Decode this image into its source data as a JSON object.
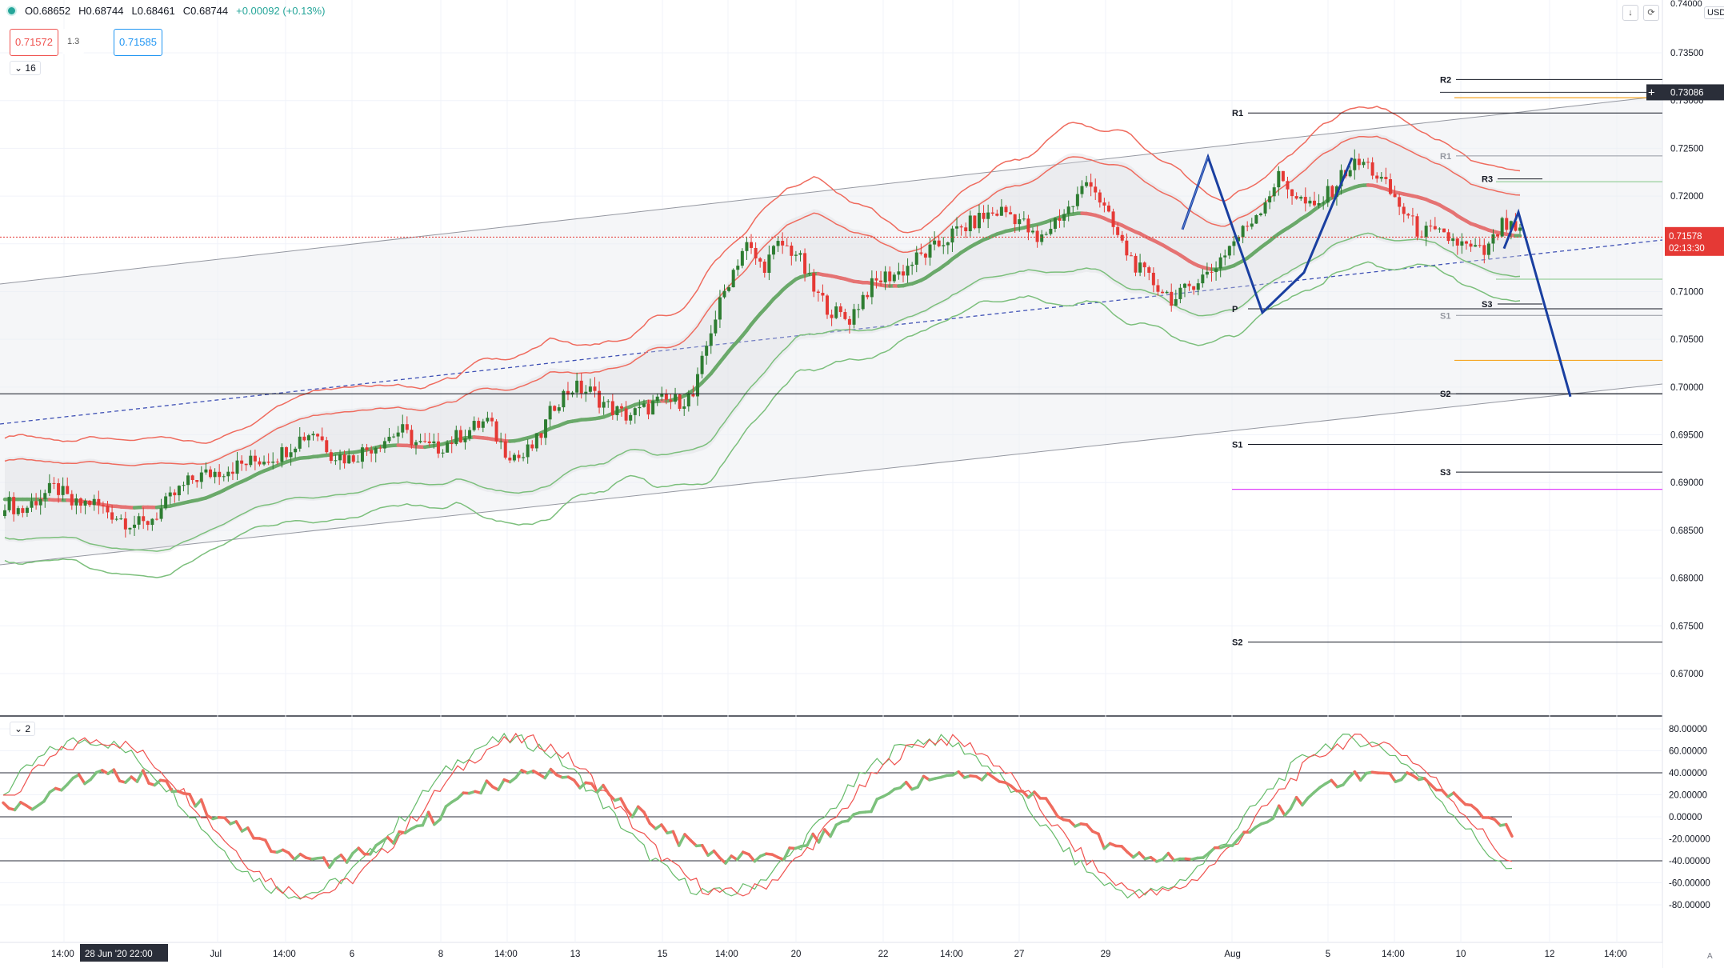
{
  "header": {
    "ohlc_open": "O0.68652",
    "ohlc_high": "H0.68744",
    "ohlc_low": "L0.68461",
    "ohlc_close": "C0.68744",
    "ohlc_change": "+0.00092 (+0.13%)",
    "sell_price": "0.71572",
    "spread": "1.3",
    "buy_price": "0.71585",
    "indicator_count_main": "16",
    "indicator_count_osc": "2",
    "currency": "USD"
  },
  "price_axis": {
    "top_label": "0.74000",
    "ticks": [
      "0.73500",
      "0.73000",
      "0.72500",
      "0.72000",
      "0.71500",
      "0.71000",
      "0.70500",
      "0.70000",
      "0.69500",
      "0.69000",
      "0.68500",
      "0.68000",
      "0.67500",
      "0.67000"
    ],
    "tick_values": [
      0.735,
      0.73,
      0.725,
      0.72,
      0.715,
      0.71,
      0.705,
      0.7,
      0.695,
      0.69,
      0.685,
      0.68,
      0.675,
      0.67
    ],
    "crosshair_price": "0.73086",
    "last_price": "0.71578",
    "countdown": "02:13:30"
  },
  "osc_axis": {
    "ticks": [
      "80.00000",
      "60.00000",
      "40.00000",
      "20.00000",
      "0.00000",
      "-20.00000",
      "-40.00000",
      "-60.00000",
      "-80.00000"
    ],
    "tick_values": [
      80,
      60,
      40,
      20,
      0,
      -20,
      -40,
      -60,
      -80
    ]
  },
  "time_axis": {
    "labels": [
      "14:00",
      "Jul",
      "14:00",
      "6",
      "8",
      "14:00",
      "13",
      "15",
      "14:00",
      "20",
      "22",
      "14:00",
      "27",
      "29",
      "Aug",
      "5",
      "14:00",
      "10",
      "12",
      "14:00"
    ],
    "crosshair_time": "28 Jun '20   22:00"
  },
  "pivots": [
    {
      "label": "R2",
      "value": 0.7322
    },
    {
      "label": "R1",
      "value": 0.7287
    },
    {
      "label": "R1",
      "value": 0.7242
    },
    {
      "label": "R3",
      "value": 0.7218
    },
    {
      "label": "S3",
      "value": 0.7087
    },
    {
      "label": "P",
      "value": 0.7082
    },
    {
      "label": "S1",
      "value": 0.7075
    },
    {
      "label": "S2",
      "value": 0.6993
    },
    {
      "label": "S1",
      "value": 0.694
    },
    {
      "label": "S3",
      "value": 0.6911
    },
    {
      "label": "S2",
      "value": 0.6733
    }
  ],
  "colors": {
    "up": "#2e7d32",
    "down": "#e53935",
    "pattern": "#1a3fa0",
    "ma_green": "#6aa96a",
    "ma_red": "#e57373",
    "band_red": "#ef6b5e",
    "band_green": "#7cbf7c",
    "orange": "#f5a623",
    "magenta": "#e040fb"
  },
  "chart_data": {
    "type": "candlestick",
    "symbol_note": "",
    "price_range": [
      0.664,
      0.74
    ],
    "oscillator_range": [
      -95,
      90
    ],
    "candles_close_path": [
      0.688,
      0.687,
      0.6885,
      0.6895,
      0.6875,
      0.688,
      0.687,
      0.686,
      0.6855,
      0.687,
      0.689,
      0.6905,
      0.691,
      0.6915,
      0.692,
      0.6925,
      0.693,
      0.6945,
      0.6955,
      0.693,
      0.6925,
      0.6935,
      0.6945,
      0.6955,
      0.694,
      0.6935,
      0.6945,
      0.6955,
      0.6965,
      0.6935,
      0.6925,
      0.6945,
      0.6985,
      0.7,
      0.6995,
      0.698,
      0.697,
      0.6975,
      0.6985,
      0.6985,
      0.699,
      0.706,
      0.711,
      0.715,
      0.7125,
      0.715,
      0.714,
      0.71,
      0.708,
      0.707,
      0.71,
      0.7115,
      0.712,
      0.7135,
      0.7145,
      0.716,
      0.717,
      0.718,
      0.7185,
      0.7175,
      0.715,
      0.7175,
      0.719,
      0.722,
      0.718,
      0.7145,
      0.712,
      0.7105,
      0.709,
      0.711,
      0.712,
      0.7145,
      0.7165,
      0.719,
      0.722,
      0.72,
      0.7185,
      0.7205,
      0.723,
      0.7235,
      0.7215,
      0.719,
      0.7165,
      0.716,
      0.7155,
      0.7145,
      0.714,
      0.717,
      0.716
    ]
  }
}
